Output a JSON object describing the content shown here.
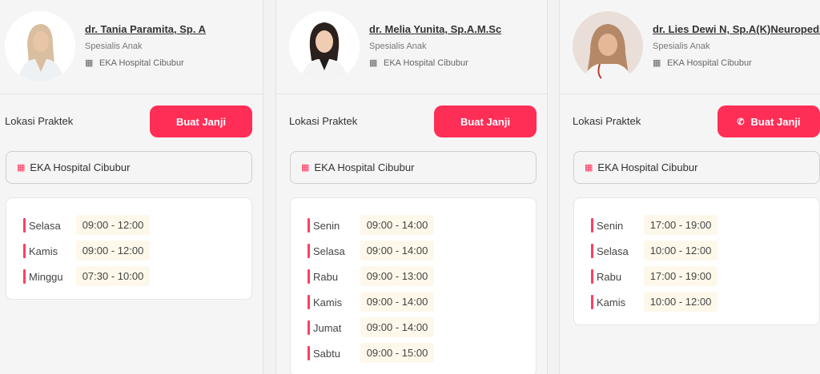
{
  "doctors": [
    {
      "name": "dr. Tania Paramita, Sp. A",
      "specialty": "Spesialis Anak",
      "hospital": "EKA Hospital Cibubur",
      "location_label": "Lokasi Praktek",
      "button_label": "Buat Janji",
      "location": "EKA Hospital Cibubur",
      "schedule": [
        {
          "day": "Selasa",
          "time": "09:00 - 12:00"
        },
        {
          "day": "Kamis",
          "time": "09:00 - 12:00"
        },
        {
          "day": "Minggu",
          "time": "07:30 - 10:00"
        }
      ]
    },
    {
      "name": "dr. Melia Yunita, Sp.A.M.Sc",
      "specialty": "Spesialis Anak",
      "hospital": "EKA Hospital Cibubur",
      "location_label": "Lokasi Praktek",
      "button_label": "Buat Janji",
      "location": "EKA Hospital Cibubur",
      "schedule": [
        {
          "day": "Senin",
          "time": "09:00 - 14:00"
        },
        {
          "day": "Selasa",
          "time": "09:00 - 14:00"
        },
        {
          "day": "Rabu",
          "time": "09:00 - 13:00"
        },
        {
          "day": "Kamis",
          "time": "09:00 - 14:00"
        },
        {
          "day": "Jumat",
          "time": "09:00 - 14:00"
        },
        {
          "day": "Sabtu",
          "time": "09:00 - 15:00"
        }
      ]
    },
    {
      "name": "dr. Lies Dewi N, Sp.A(K)Neuropediatri",
      "specialty": "Spesialis Anak",
      "hospital": "EKA Hospital Cibubur",
      "location_label": "Lokasi Praktek",
      "button_label": "Buat Janji",
      "location": "EKA Hospital Cibubur",
      "schedule": [
        {
          "day": "Senin",
          "time": "17:00 - 19:00"
        },
        {
          "day": "Selasa",
          "time": "10:00 - 12:00"
        },
        {
          "day": "Rabu",
          "time": "17:00 - 19:00"
        },
        {
          "day": "Kamis",
          "time": "10:00 - 12:00"
        }
      ]
    }
  ],
  "colors": {
    "accent": "#ff2e57",
    "time_bg": "#fdf8ea",
    "card_bg": "#f5f5f5"
  },
  "icons": {
    "hospital": "hospital-icon",
    "phone": "phone-icon"
  }
}
